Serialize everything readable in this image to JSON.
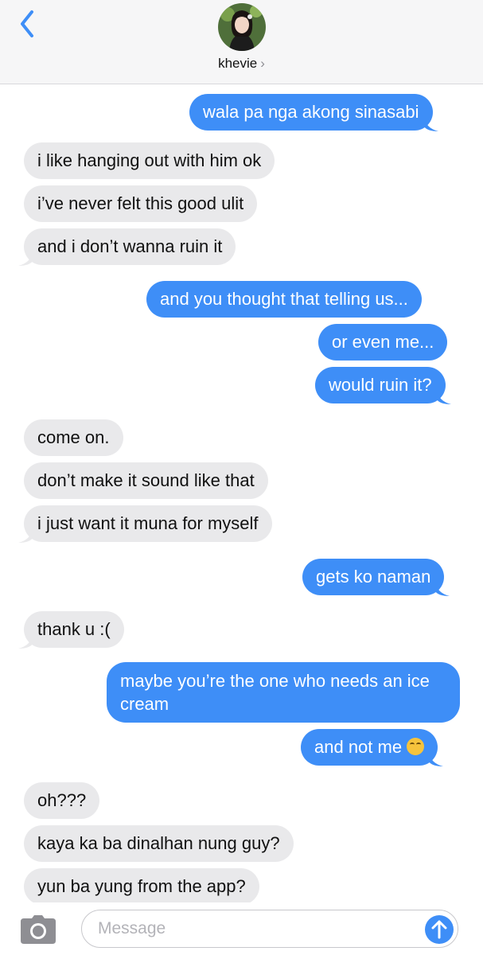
{
  "header": {
    "contact_name": "khevie",
    "chevron": "›",
    "back_icon": "chevron-left-icon",
    "accent": "#3e8ef7"
  },
  "messages": [
    {
      "dir": "out",
      "text": "wala pa nga akong sinasabi"
    },
    {
      "dir": "in",
      "text": "i like hanging out with him ok"
    },
    {
      "dir": "in",
      "text": "i’ve never felt this good ulit"
    },
    {
      "dir": "in",
      "text": "and i don’t wanna ruin it"
    },
    {
      "dir": "out",
      "text": "and you thought that telling us..."
    },
    {
      "dir": "out",
      "text": "or even me..."
    },
    {
      "dir": "out",
      "text": "would ruin it?"
    },
    {
      "dir": "in",
      "text": "come on."
    },
    {
      "dir": "in",
      "text": "don’t make it sound like that"
    },
    {
      "dir": "in",
      "text": "i just want it muna for myself"
    },
    {
      "dir": "out",
      "text": "gets ko naman"
    },
    {
      "dir": "in",
      "text": "thank u :("
    },
    {
      "dir": "out",
      "text": "maybe you’re the one who needs an ice cream"
    },
    {
      "dir": "out",
      "text": "and not me",
      "emoji": "face-with-tears-of-joy-icon"
    },
    {
      "dir": "in",
      "text": "oh???"
    },
    {
      "dir": "in",
      "text": "kaya ka ba dinalhan nung guy?"
    },
    {
      "dir": "in",
      "text": "yun ba yung from the app?"
    }
  ],
  "composer": {
    "placeholder": "Message",
    "camera_icon": "camera-icon",
    "send_icon": "arrow-up-icon"
  },
  "colors": {
    "outgoing_bubble": "#3e8ef7",
    "incoming_bubble": "#e9e9eb",
    "header_bg": "#f6f6f7"
  }
}
